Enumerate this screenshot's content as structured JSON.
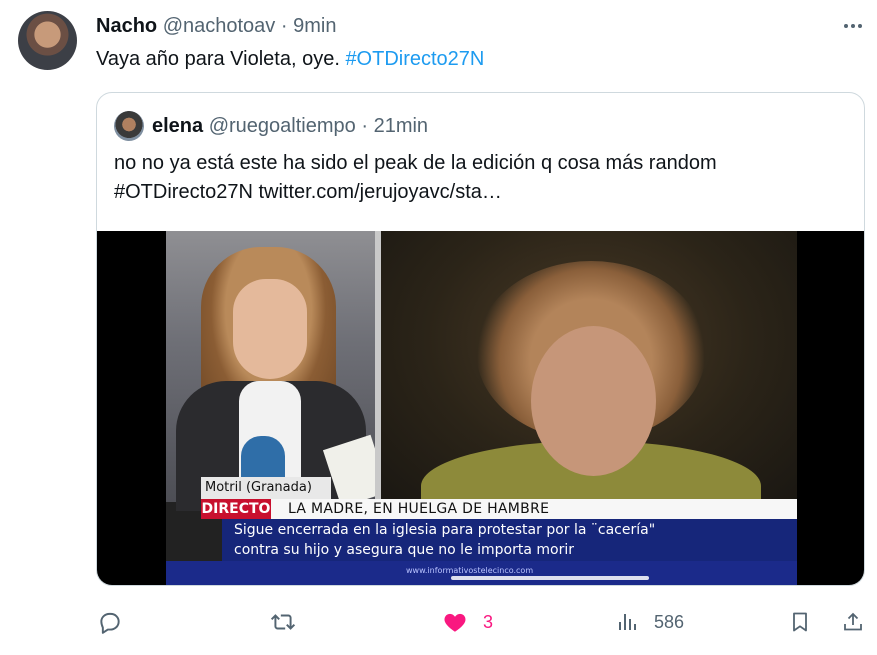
{
  "tweet": {
    "author_name": "Nacho",
    "handle": "@nachotoav",
    "separator": "·",
    "time": "9min",
    "text_plain": "Vaya año para Violeta, oye. ",
    "text_hashtag": "#OTDirecto27N"
  },
  "quoted": {
    "author_name": "elena",
    "handle": "@ruegoaltiempo",
    "separator": "·",
    "time": "21min",
    "line1": "no no ya está este ha sido el peak de la edición q cosa más random",
    "line2": "#OTDirecto27N  twitter.com/jerujoyavc/sta…"
  },
  "video": {
    "location": "Motril (Granada)",
    "badge": "DIRECTO",
    "headline": "LA MADRE, EN HUELGA DE HAMBRE",
    "subtitle_line1": "Sigue encerrada en la iglesia para protestar por la ¨cacería\"",
    "subtitle_line2": "contra su hijo y asegura que no le importa morir",
    "url": "www.informativostelecinco.com",
    "progress": 0.0
  },
  "actions": {
    "likes": "3",
    "views": "586"
  },
  "colors": {
    "accent": "#1d9bf0",
    "like": "#f91880",
    "muted": "#536471",
    "border": "#cfd9de"
  },
  "icons": [
    "more-icon",
    "reply-icon",
    "retweet-icon",
    "like-icon",
    "views-icon",
    "bookmark-icon",
    "share-icon"
  ]
}
